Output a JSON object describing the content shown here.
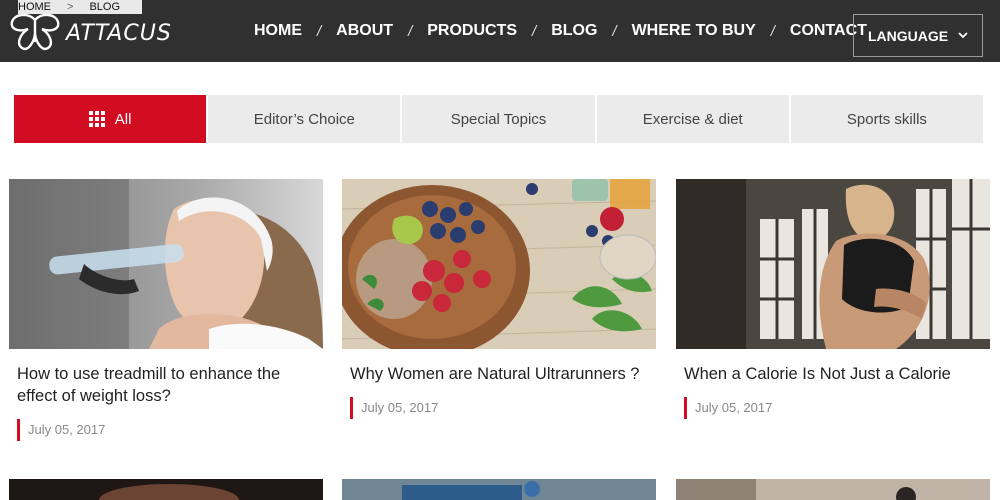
{
  "breadcrumb": {
    "home": "HOME",
    "separator": ">",
    "current": "BLOG"
  },
  "logo": {
    "text": "ATTACUS"
  },
  "nav": {
    "items": [
      "HOME",
      "ABOUT",
      "PRODUCTS",
      "BLOG",
      "WHERE TO BUY",
      "CONTACT"
    ],
    "separator": "/"
  },
  "language": {
    "label": "LANGUAGE"
  },
  "tabs": [
    "All",
    "Editor’s Choice",
    "Special Topics",
    "Exercise & diet",
    "Sports skills"
  ],
  "articles": [
    {
      "title": "How to use treadmill to enhance the effect of weight loss?",
      "date": "July 05, 2017"
    },
    {
      "title": "Why Women are Natural Ultrarunners ?",
      "date": "July 05, 2017"
    },
    {
      "title": "When a Calorie Is Not Just a Calorie",
      "date": "July 05, 2017"
    }
  ],
  "colors": {
    "accent": "#d20d21",
    "header_bg": "#303030",
    "tab_bg": "#ebebeb"
  }
}
